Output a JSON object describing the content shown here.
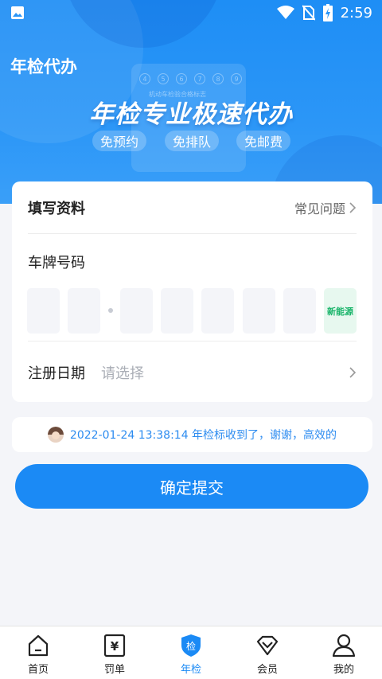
{
  "status_bar": {
    "time": "2:59",
    "icons": [
      "image-icon",
      "wifi-icon",
      "no-sim-icon",
      "battery-charging-icon"
    ]
  },
  "header": {
    "title": "年检代办"
  },
  "banner": {
    "slogan": "年检专业极速代办",
    "sticker_label": "机动车检验合格标志",
    "tags": [
      "免预约",
      "免排队",
      "免邮费"
    ]
  },
  "form": {
    "title": "填写资料",
    "faq_link": "常见问题",
    "plate_label": "车牌号码",
    "new_energy_label": "新能源",
    "reg_date_label": "注册日期",
    "reg_date_placeholder": "请选择"
  },
  "notice": {
    "message": "2022-01-24 13:38:14 年检标收到了，谢谢，高效的"
  },
  "submit_label": "确定提交",
  "tabs": [
    {
      "label": "首页",
      "icon": "home-icon"
    },
    {
      "label": "罚单",
      "icon": "ticket-yuan-icon"
    },
    {
      "label": "年检",
      "icon": "inspection-shield-icon"
    },
    {
      "label": "会员",
      "icon": "diamond-icon"
    },
    {
      "label": "我的",
      "icon": "user-icon"
    }
  ],
  "tab_shield_glyph": "检",
  "ticket_glyph": "¥",
  "colors": {
    "primary": "#1b8af5",
    "new_energy_text": "#19b46a",
    "new_energy_bg": "#e7f8ef",
    "notice_text": "#2d8cf0"
  }
}
